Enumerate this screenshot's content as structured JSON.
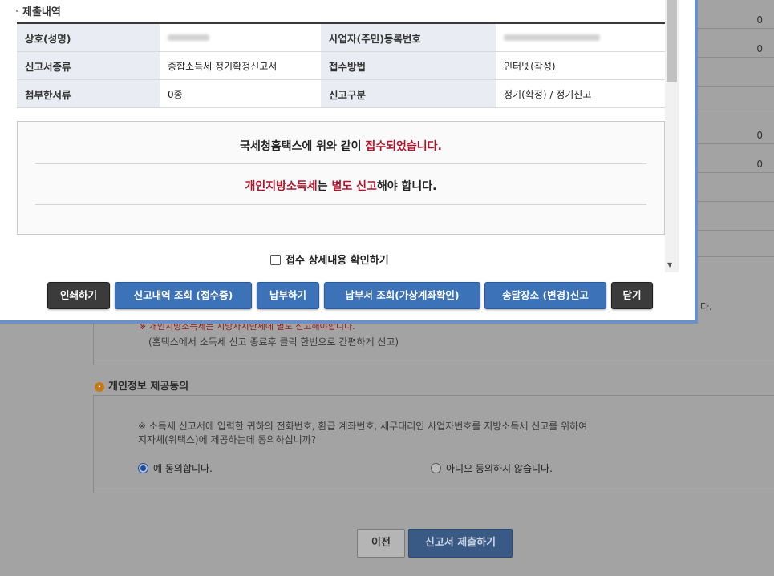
{
  "background": {
    "right_table_values": [
      "0",
      "0",
      "",
      "",
      "0",
      "0",
      "",
      ""
    ],
    "box1_tail": "다.",
    "box1_note_red": "※ 개인지방소득세는 지방자치단체에 별도 신고해야합니다.",
    "box1_note": "(홈택스에서 소득세 신고 종료후 클릭 한번으로 간편하게 신고)",
    "consent_title": "개인정보 제공동의",
    "consent_q1": "※ 소득세 신고서에 입력한 귀하의 전화번호, 환급 계좌번호, 세무대리인 사업자번호를 지방소득세 신고를 위하여",
    "consent_q2": "지자체(위택스)에 제공하는데 동의하십니까?",
    "radio_yes": "예 동의합니다.",
    "radio_no": "아니오 동의하지 않습니다.",
    "prev_button": "이전",
    "submit_button": "신고서 제출하기"
  },
  "modal": {
    "section_title": "제출내역",
    "table": {
      "r1": {
        "label_a": "상호(성명)",
        "value_a": "",
        "label_b": "사업자(주민)등록번호",
        "value_b": ""
      },
      "r2": {
        "label_a": "신고서종류",
        "value_a": "종합소득세 정기확정신고서",
        "label_b": "접수방법",
        "value_b": "인터넷(작성)"
      },
      "r3": {
        "label_a": "첨부한서류",
        "value_a": "0종",
        "label_b": "신고구분",
        "value_b": "정기(확정) / 정기신고"
      }
    },
    "message": {
      "line1_pre": "국세청홈택스에 위와 같이 ",
      "line1_red": "접수되었습니다.",
      "line2_red1": "개인지방소득세",
      "line2_mid1": "는 ",
      "line2_red2": "별도 신고",
      "line2_end": "해야 합니다."
    },
    "checkbox_label": "접수 상세내용 확인하기",
    "buttons": {
      "print": "인쇄하기",
      "history": "신고내역 조회 (접수증)",
      "pay": "납부하기",
      "bill": "납부서 조회(가상계좌확인)",
      "delivery": "송달장소 (변경)신고",
      "close": "닫기"
    }
  }
}
